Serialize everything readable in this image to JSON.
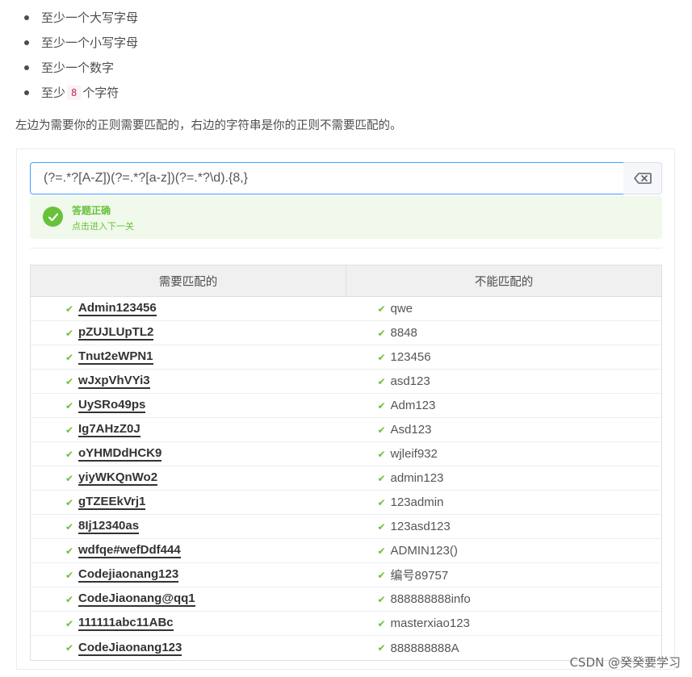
{
  "requirements": {
    "item1": "至少一个大写字母",
    "item2": "至少一个小写字母",
    "item3": "至少一个数字",
    "item4_prefix": "至少",
    "item4_code": "8",
    "item4_suffix": "个字符"
  },
  "description": "左边为需要你的正则需要匹配的，右边的字符串是你的正则不需要匹配的。",
  "regex": {
    "value": "(?=.*?[A-Z])(?=.*?[a-z])(?=.*?\\d).{8,}"
  },
  "result": {
    "title": "答题正确",
    "subtitle": "点击进入下一关",
    "color": "#67c23a"
  },
  "table": {
    "col_match": "需要匹配的",
    "col_nomatch": "不能匹配的",
    "rows": [
      {
        "match": "Admin123456",
        "nomatch": "qwe"
      },
      {
        "match": "pZUJLUpTL2",
        "nomatch": "8848"
      },
      {
        "match": "Tnut2eWPN1",
        "nomatch": "123456"
      },
      {
        "match": "wJxpVhVYi3",
        "nomatch": "asd123"
      },
      {
        "match": "UySRo49ps",
        "nomatch": "Adm123"
      },
      {
        "match": "Ig7AHzZ0J",
        "nomatch": "Asd123"
      },
      {
        "match": "oYHMDdHCK9",
        "nomatch": "wjleif932"
      },
      {
        "match": "yiyWKQnWo2",
        "nomatch": "admin123"
      },
      {
        "match": "gTZEEkVrj1",
        "nomatch": "123admin"
      },
      {
        "match": "8Ij12340as",
        "nomatch": "123asd123"
      },
      {
        "match": "wdfqe#wefDdf444",
        "nomatch": "ADMIN123()"
      },
      {
        "match": "Codejiaonang123",
        "nomatch": "编号89757"
      },
      {
        "match": "CodeJiaonang@qq1",
        "nomatch": "888888888info"
      },
      {
        "match": "111111abc11ABc",
        "nomatch": "masterxiao123"
      },
      {
        "match": "CodeJiaonang123",
        "nomatch": "888888888A"
      }
    ]
  },
  "watermark": "CSDN @癸癸要学习",
  "icons": {
    "clear": "backspace-icon",
    "success": "check-circle-icon",
    "row_tick": "check-icon"
  }
}
